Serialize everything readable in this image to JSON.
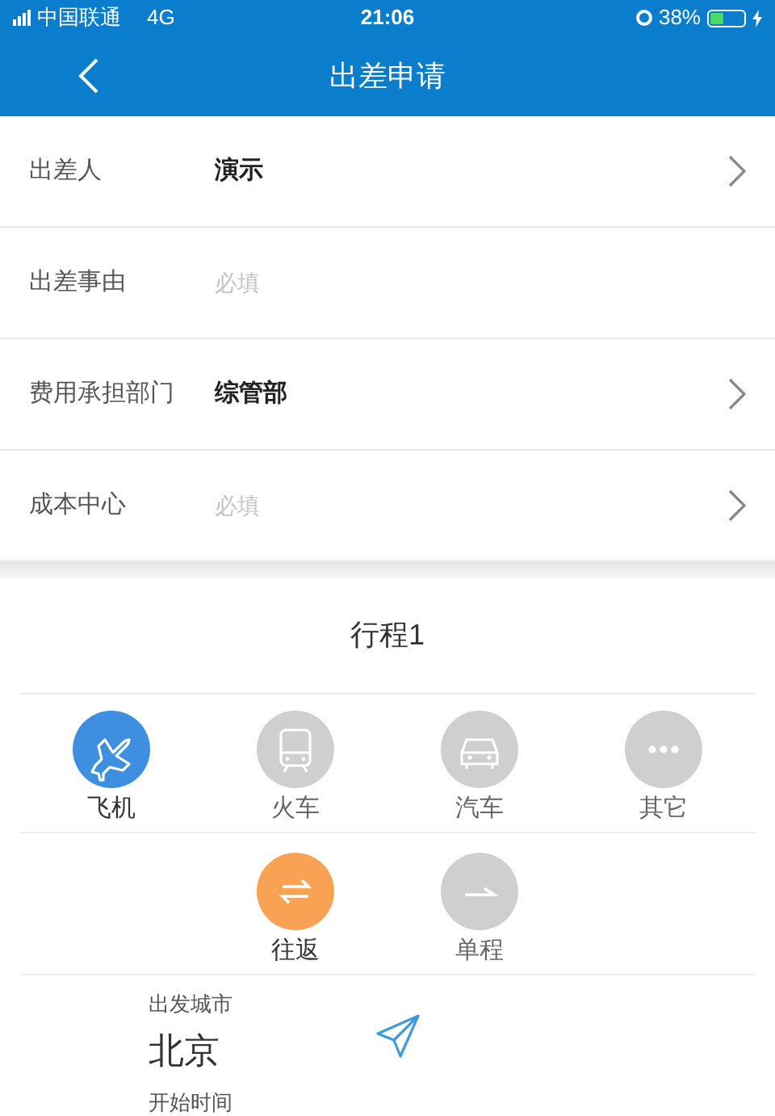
{
  "status_bar": {
    "carrier": "中国联通",
    "network": "4G",
    "time": "21:06",
    "battery": "38%"
  },
  "nav": {
    "title": "出差申请"
  },
  "form_rows": [
    {
      "label": "出差人",
      "value": "演示",
      "placeholder": null,
      "chevron": true
    },
    {
      "label": "出差事由",
      "value": null,
      "placeholder": "必填",
      "chevron": false
    },
    {
      "label": "费用承担部门",
      "value": "综管部",
      "placeholder": null,
      "chevron": true
    },
    {
      "label": "成本中心",
      "value": null,
      "placeholder": "必填",
      "chevron": true
    }
  ],
  "trip": {
    "title": "行程1",
    "transport": [
      {
        "kind": "plane",
        "label": "飞机",
        "selected": true
      },
      {
        "kind": "train",
        "label": "火车",
        "selected": false
      },
      {
        "kind": "car",
        "label": "汽车",
        "selected": false
      },
      {
        "kind": "other",
        "label": "其它",
        "selected": false
      }
    ],
    "trip_type": [
      {
        "kind": "round",
        "label": "往返",
        "selected": true
      },
      {
        "kind": "oneway",
        "label": "单程",
        "selected": false
      }
    ],
    "departure": {
      "label": "出发城市",
      "value": "北京"
    },
    "start_time": {
      "label": "开始时间"
    }
  }
}
